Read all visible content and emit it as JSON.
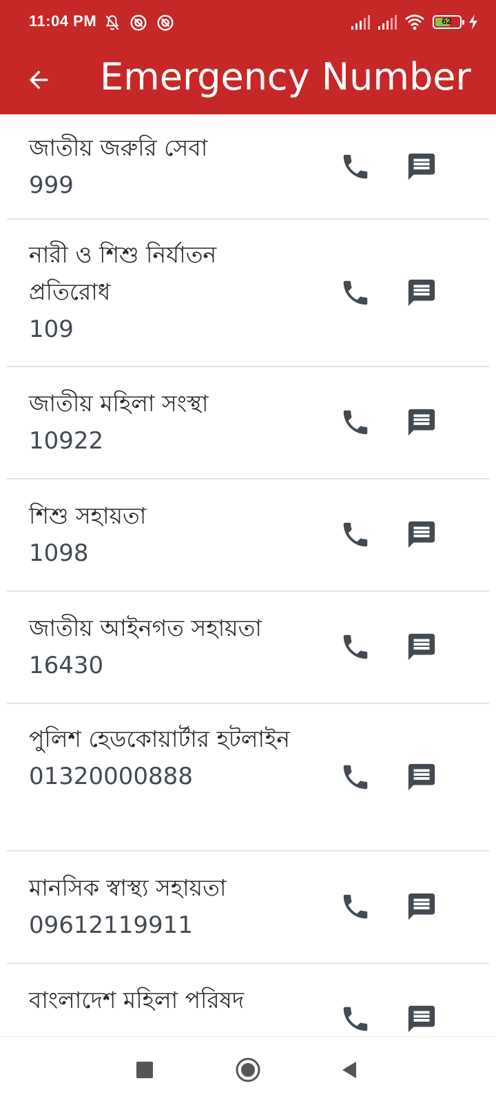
{
  "status_bar": {
    "time": "11:04 PM",
    "battery_level": 62,
    "battery_label": "62",
    "icons_left": [
      "bell-off-icon",
      "dnd-icon",
      "dnd-icon"
    ],
    "icons_right": [
      "signal-icon",
      "signal-icon",
      "wifi-icon",
      "battery-icon",
      "charging-bolt-icon"
    ]
  },
  "app_bar": {
    "title": "Emergency Number",
    "back_icon": "arrow-back-icon"
  },
  "colors": {
    "app_bar_background": "#c62828",
    "icon_color": "#444a52",
    "battery_fill": "#8bc34a"
  },
  "contacts": [
    {
      "name": "জাতীয় জরুরি সেবা",
      "number": "999"
    },
    {
      "name": "নারী ও শিশু নির্যাতন প্রতিরোধ",
      "number": "109"
    },
    {
      "name": "জাতীয় মহিলা সংস্থা",
      "number": "10922"
    },
    {
      "name": "শিশু সহায়তা",
      "number": "1098"
    },
    {
      "name": "জাতীয় আইনগত সহায়তা",
      "number": "16430"
    },
    {
      "name": "পুলিশ হেডকোয়ার্টার হটলাইন",
      "number": "01320000888"
    },
    {
      "name": "মানসিক স্বাস্থ্য সহায়তা",
      "number": "09612119911"
    },
    {
      "name": "বাংলাদেশ মহিলা পরিষদ",
      "number": ""
    }
  ],
  "row_icons": {
    "call": "phone-icon",
    "message": "message-icon"
  },
  "nav_bar": {
    "items": [
      "recents-square-icon",
      "home-circle-icon",
      "back-triangle-icon"
    ]
  }
}
